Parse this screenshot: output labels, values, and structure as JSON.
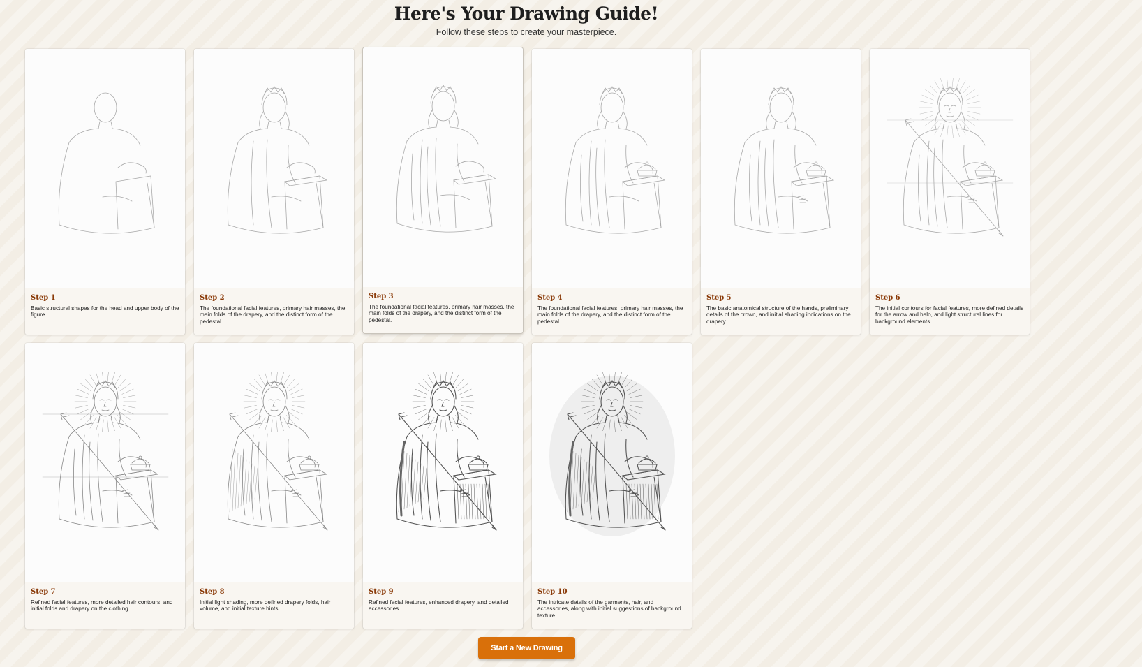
{
  "header": {
    "title": "Here's Your Drawing Guide!",
    "subtitle": "Follow these steps to create your masterpiece."
  },
  "steps": [
    {
      "label": "Step 1",
      "description": "Basic structural shapes for the head and upper body of the figure.",
      "detail_level": 1
    },
    {
      "label": "Step 2",
      "description": "The foundational facial features, primary hair masses, the main folds of the drapery, and the distinct form of the pedestal.",
      "detail_level": 2
    },
    {
      "label": "Step 3",
      "description": "The foundational facial features, primary hair masses, the main folds of the drapery, and the distinct form of the pedestal.",
      "detail_level": 3
    },
    {
      "label": "Step 4",
      "description": "The foundational facial features, primary hair masses, the main folds of the drapery, and the distinct form of the pedestal.",
      "detail_level": 4
    },
    {
      "label": "Step 5",
      "description": "The basic anatomical structure of the hands, preliminary details of the crown, and initial shading indications on the drapery.",
      "detail_level": 5
    },
    {
      "label": "Step 6",
      "description": "The initial contours for facial features, more defined details for the arrow and halo, and light structural lines for background elements.",
      "detail_level": 6
    },
    {
      "label": "Step 7",
      "description": "Refined facial features, more detailed hair contours, and initial folds and drapery on the clothing.",
      "detail_level": 7
    },
    {
      "label": "Step 8",
      "description": "Initial light shading, more defined drapery folds, hair volume, and initial texture hints.",
      "detail_level": 8
    },
    {
      "label": "Step 9",
      "description": "Refined facial features, enhanced drapery, and detailed accessories.",
      "detail_level": 9
    },
    {
      "label": "Step 10",
      "description": "The intricate details of the garments, hair, and accessories, along with initial suggestions of background texture.",
      "detail_level": 10
    }
  ],
  "actions": {
    "new_drawing_label": "Start a New Drawing"
  },
  "colors": {
    "accent": "#d9700a",
    "step_label": "#8a3a08",
    "background": "#f3eee5"
  }
}
